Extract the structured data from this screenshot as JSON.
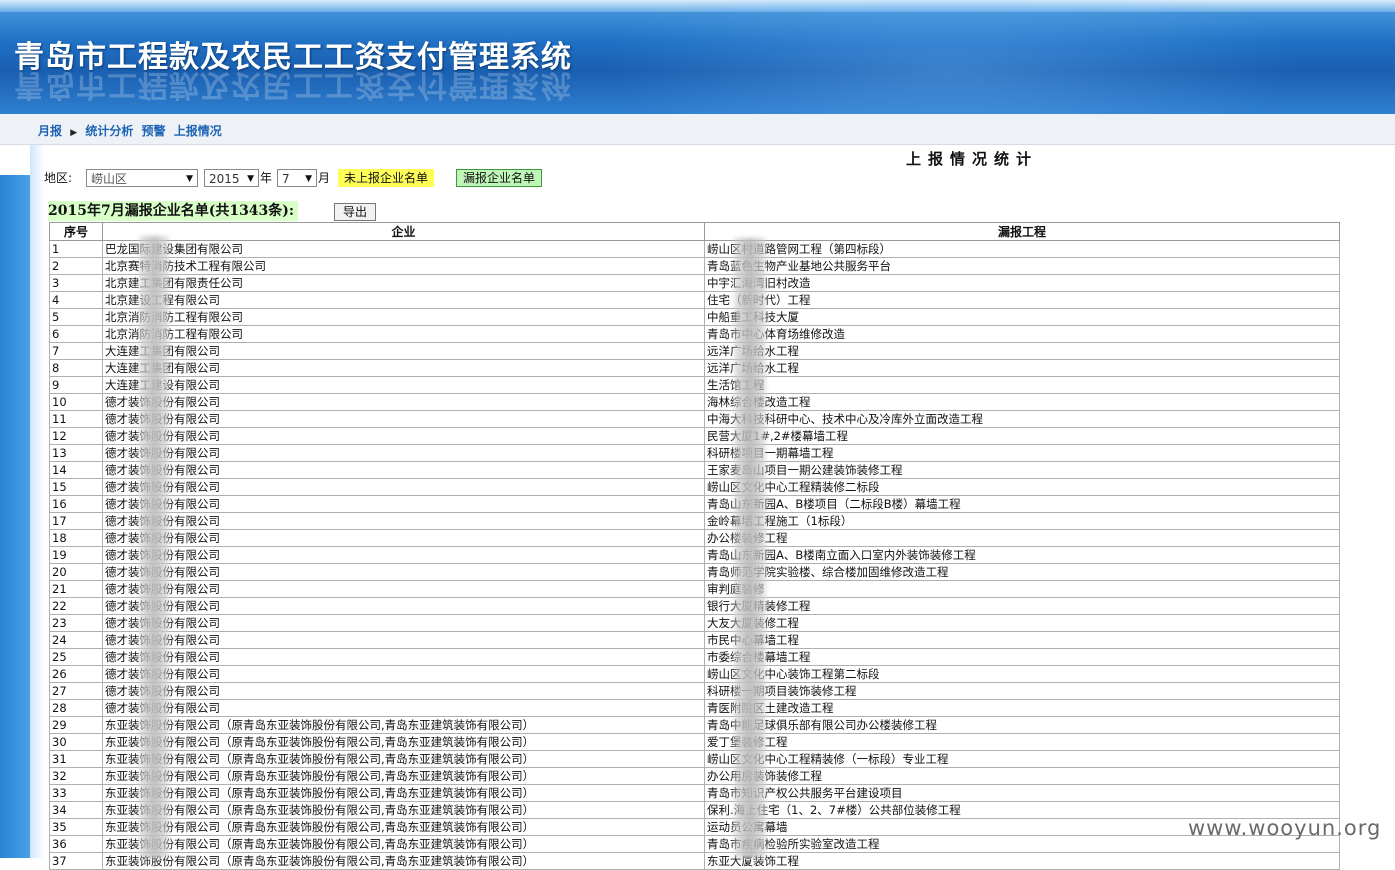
{
  "header": {
    "title": "青岛市工程款及农民工工资支付管理系统"
  },
  "nav": {
    "item1": "月报",
    "item2": "统计分析",
    "item3": "预警",
    "item4": "上报情况"
  },
  "page": {
    "title": "上报情况统计"
  },
  "filters": {
    "region_label": "地区:",
    "region_value": "崂山区",
    "year_value": "2015",
    "year_unit": "年",
    "month_value": "7",
    "month_unit": "月",
    "not_reported_button": "未上报企业名单",
    "missed_button": "漏报企业名单"
  },
  "list": {
    "title": "2015年7月漏报企业名单(共1343条):",
    "export_label": "导出"
  },
  "table": {
    "headers": {
      "index": "序号",
      "company": "企业",
      "project": "漏报工程"
    },
    "rows": [
      [
        "1",
        "巴龙国际建设集团有限公司",
        "崂山区村道路管网工程（第四标段）"
      ],
      [
        "2",
        "北京赛特消防技术工程有限公司",
        "青岛蓝色生物产业基地公共服务平台"
      ],
      [
        "3",
        "北京建工集团有限责任公司",
        "中宇汇海湾旧村改造"
      ],
      [
        "4",
        "北京建设工程有限公司",
        "住宅（新时代）工程"
      ],
      [
        "5",
        "北京消防消防工程有限公司",
        "中船重工科技大厦"
      ],
      [
        "6",
        "北京消防消防工程有限公司",
        "青岛市中心体育场维修改造"
      ],
      [
        "7",
        "大连建工集团有限公司",
        "远洋广场给水工程"
      ],
      [
        "8",
        "大连建工集团有限公司",
        "远洋广场给水工程"
      ],
      [
        "9",
        "大连建工建设有限公司",
        "生活馆工程"
      ],
      [
        "10",
        "德才装饰股份有限公司",
        "海林综合楼改造工程"
      ],
      [
        "11",
        "德才装饰股份有限公司",
        "中海大科技科研中心、技术中心及冷库外立面改造工程"
      ],
      [
        "12",
        "德才装饰股份有限公司",
        "民营大厦1#,2#楼幕墙工程"
      ],
      [
        "13",
        "德才装饰股份有限公司",
        "科研楼项目一期幕墙工程"
      ],
      [
        "14",
        "德才装饰股份有限公司",
        "王家麦岛山项目一期公建装饰装修工程"
      ],
      [
        "15",
        "德才装饰股份有限公司",
        "崂山区文化中心工程精装修二标段"
      ],
      [
        "16",
        "德才装饰股份有限公司",
        "青岛山东新园A、B楼项目（二标段B楼）幕墙工程"
      ],
      [
        "17",
        "德才装饰股份有限公司",
        "金岭幕墙工程施工（1标段）"
      ],
      [
        "18",
        "德才装饰股份有限公司",
        "办公楼装修工程"
      ],
      [
        "19",
        "德才装饰股份有限公司",
        "青岛山东新园A、B楼南立面入口室内外装饰装修工程"
      ],
      [
        "20",
        "德才装饰股份有限公司",
        "青岛师范学院实验楼、综合楼加固维修改造工程"
      ],
      [
        "21",
        "德才装饰股份有限公司",
        "审判庭装修"
      ],
      [
        "22",
        "德才装饰股份有限公司",
        "银行大厦精装修工程"
      ],
      [
        "23",
        "德才装饰股份有限公司",
        "大友大厦装修工程"
      ],
      [
        "24",
        "德才装饰股份有限公司",
        "市民中心幕墙工程"
      ],
      [
        "25",
        "德才装饰股份有限公司",
        "市委综合楼幕墙工程"
      ],
      [
        "26",
        "德才装饰股份有限公司",
        "崂山区文化中心装饰工程第二标段"
      ],
      [
        "27",
        "德才装饰股份有限公司",
        "科研楼一期项目装饰装修工程"
      ],
      [
        "28",
        "德才装饰股份有限公司",
        "青医附院区土建改造工程"
      ],
      [
        "29",
        "东亚装饰股份有限公司（原青岛东亚装饰股份有限公司,青岛东亚建筑装饰有限公司）",
        "青岛中能足球俱乐部有限公司办公楼装修工程"
      ],
      [
        "30",
        "东亚装饰股份有限公司（原青岛东亚装饰股份有限公司,青岛东亚建筑装饰有限公司）",
        "爱丁堡装修工程"
      ],
      [
        "31",
        "东亚装饰股份有限公司（原青岛东亚装饰股份有限公司,青岛东亚建筑装饰有限公司）",
        "崂山区文化中心工程精装修（一标段）专业工程"
      ],
      [
        "32",
        "东亚装饰股份有限公司（原青岛东亚装饰股份有限公司,青岛东亚建筑装饰有限公司）",
        "办公用房装饰装修工程"
      ],
      [
        "33",
        "东亚装饰股份有限公司（原青岛东亚装饰股份有限公司,青岛东亚建筑装饰有限公司）",
        "青岛市知识产权公共服务平台建设项目"
      ],
      [
        "34",
        "东亚装饰股份有限公司（原青岛东亚装饰股份有限公司,青岛东亚建筑装饰有限公司）",
        "保利.海上住宅（1、2、7#楼）公共部位装修工程"
      ],
      [
        "35",
        "东亚装饰股份有限公司（原青岛东亚装饰股份有限公司,青岛东亚建筑装饰有限公司）",
        "运动员公寓幕墙"
      ],
      [
        "36",
        "东亚装饰股份有限公司（原青岛东亚装饰股份有限公司,青岛东亚建筑装饰有限公司）",
        "青岛市疾病检验所实验室改造工程"
      ],
      [
        "37",
        "东亚装饰股份有限公司（原青岛东亚装饰股份有限公司,青岛东亚建筑装饰有限公司）",
        "东亚大厦装饰工程"
      ]
    ]
  },
  "watermark": "www.wooyun.org"
}
